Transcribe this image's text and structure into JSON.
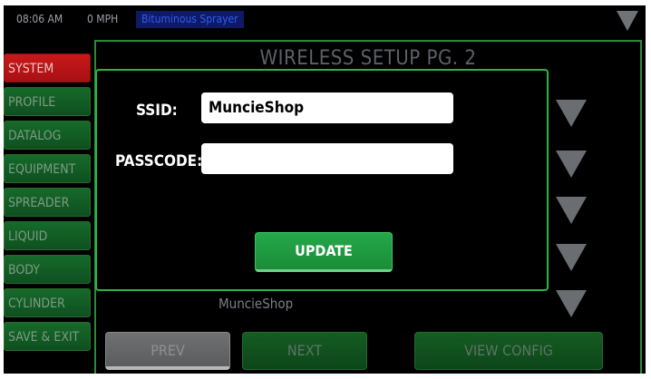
{
  "status": {
    "time": "08:06 AM",
    "speed": "0 MPH",
    "mode": "Bituminous Sprayer",
    "menu_icon": "triangle-down-icon"
  },
  "sidebar": {
    "items": [
      {
        "label": "SYSTEM",
        "active": true
      },
      {
        "label": "PROFILE",
        "active": false
      },
      {
        "label": "DATALOG",
        "active": false
      },
      {
        "label": "EQUIPMENT",
        "active": false
      },
      {
        "label": "SPREADER",
        "active": false
      },
      {
        "label": "LIQUID",
        "active": false
      },
      {
        "label": "BODY",
        "active": false
      },
      {
        "label": "CYLINDER",
        "active": false
      },
      {
        "label": "SAVE & EXIT",
        "active": false
      }
    ]
  },
  "main": {
    "title": "WIRELESS SETUP PG. 2",
    "ssid_display": "MuncieShop",
    "row_icon": "triangle-down-icon"
  },
  "modal": {
    "ssid_label": "SSID:",
    "ssid_value": "MuncieShop",
    "passcode_label": "PASSCODE:",
    "passcode_value": "",
    "update_label": "UPDATE"
  },
  "footer": {
    "prev_label": "PREV",
    "next_label": "NEXT",
    "view_config_label": "VIEW CONFIG"
  },
  "colors": {
    "active_tab": "#c9181a",
    "tab": "#166a2a",
    "accent_green": "#2bb34a",
    "mode_badge": "#0f1a66"
  }
}
